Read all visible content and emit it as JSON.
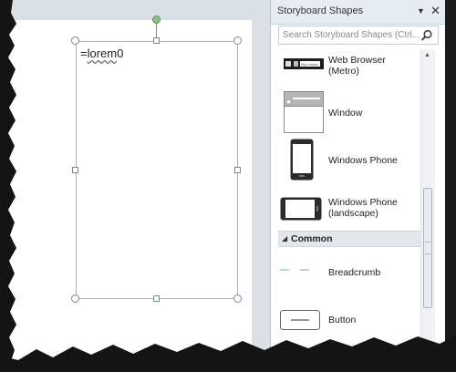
{
  "canvas": {
    "shape_text_prefix": "=",
    "shape_text_word": "lorem",
    "shape_text_suffix": "0"
  },
  "panel": {
    "title": "Storyboard Shapes",
    "dropdown_icon": "dropdown-arrow-icon",
    "close_icon": "close-icon",
    "search_placeholder": "Search Storyboard Shapes (Ctrl...",
    "search_icon": "search-icon",
    "items": [
      {
        "label_line1": "Web Browser",
        "label_line2": "(Metro)",
        "thumb_text": "http://www",
        "icon": "web-browser-icon"
      },
      {
        "label_line1": "Window",
        "label_line2": "",
        "icon": "window-icon"
      },
      {
        "label_line1": "Windows Phone",
        "label_line2": "",
        "icon": "windows-phone-icon"
      },
      {
        "label_line1": "Windows Phone",
        "label_line2": "(landscape)",
        "icon": "windows-phone-landscape-icon"
      }
    ],
    "section": {
      "label": "Common",
      "icon": "collapse-arrow-icon"
    },
    "common_items": [
      {
        "label_line1": "Breadcrumb",
        "icon": "breadcrumb-icon"
      },
      {
        "label_line1": "Button",
        "icon": "button-icon"
      }
    ]
  },
  "colors": {
    "panel_header": "#e7ecf2",
    "section_bg": "#e3e7ec",
    "rotate_handle": "#8bc08a",
    "selection_border": "#a9b4c0"
  }
}
